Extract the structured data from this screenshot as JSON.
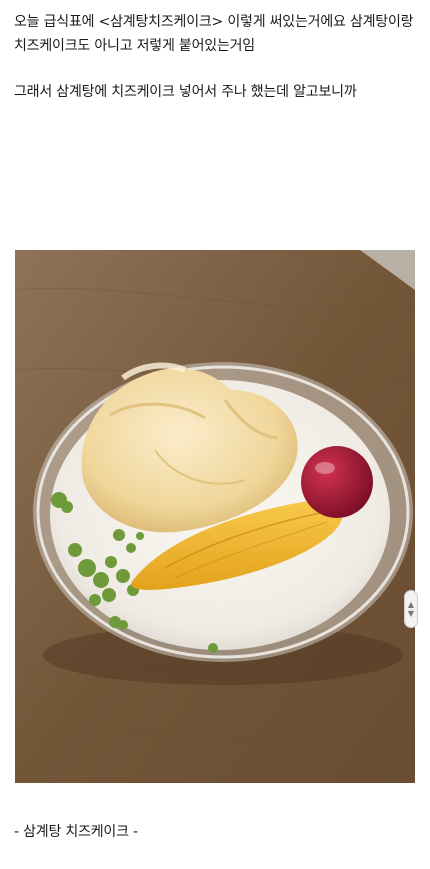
{
  "post": {
    "paragraph_1": "오늘 급식표에 <삼계탕치즈케이크> 이렇게 써있는거에요 삼계탕이랑 치즈케이크도 아니고 저렇게 붙어있는거임",
    "paragraph_2": "그래서 삼계탕에 치즈케이크 넣어서 주나 했는데 알고보니까",
    "caption": "- 삼계탕 치즈케이크 -"
  },
  "photo": {
    "subject": "samgyetang-cheesecake-photo",
    "colors": {
      "table": "#7a5e42",
      "cream": "#f3efe8",
      "chicken": "#f1d9a0",
      "ginseng": "#f0b52c",
      "jujube": "#9c1431",
      "herb": "#6f9a3a"
    }
  },
  "scroll_handle": {
    "up_icon": "chevron-up-icon",
    "down_icon": "chevron-down-icon"
  }
}
